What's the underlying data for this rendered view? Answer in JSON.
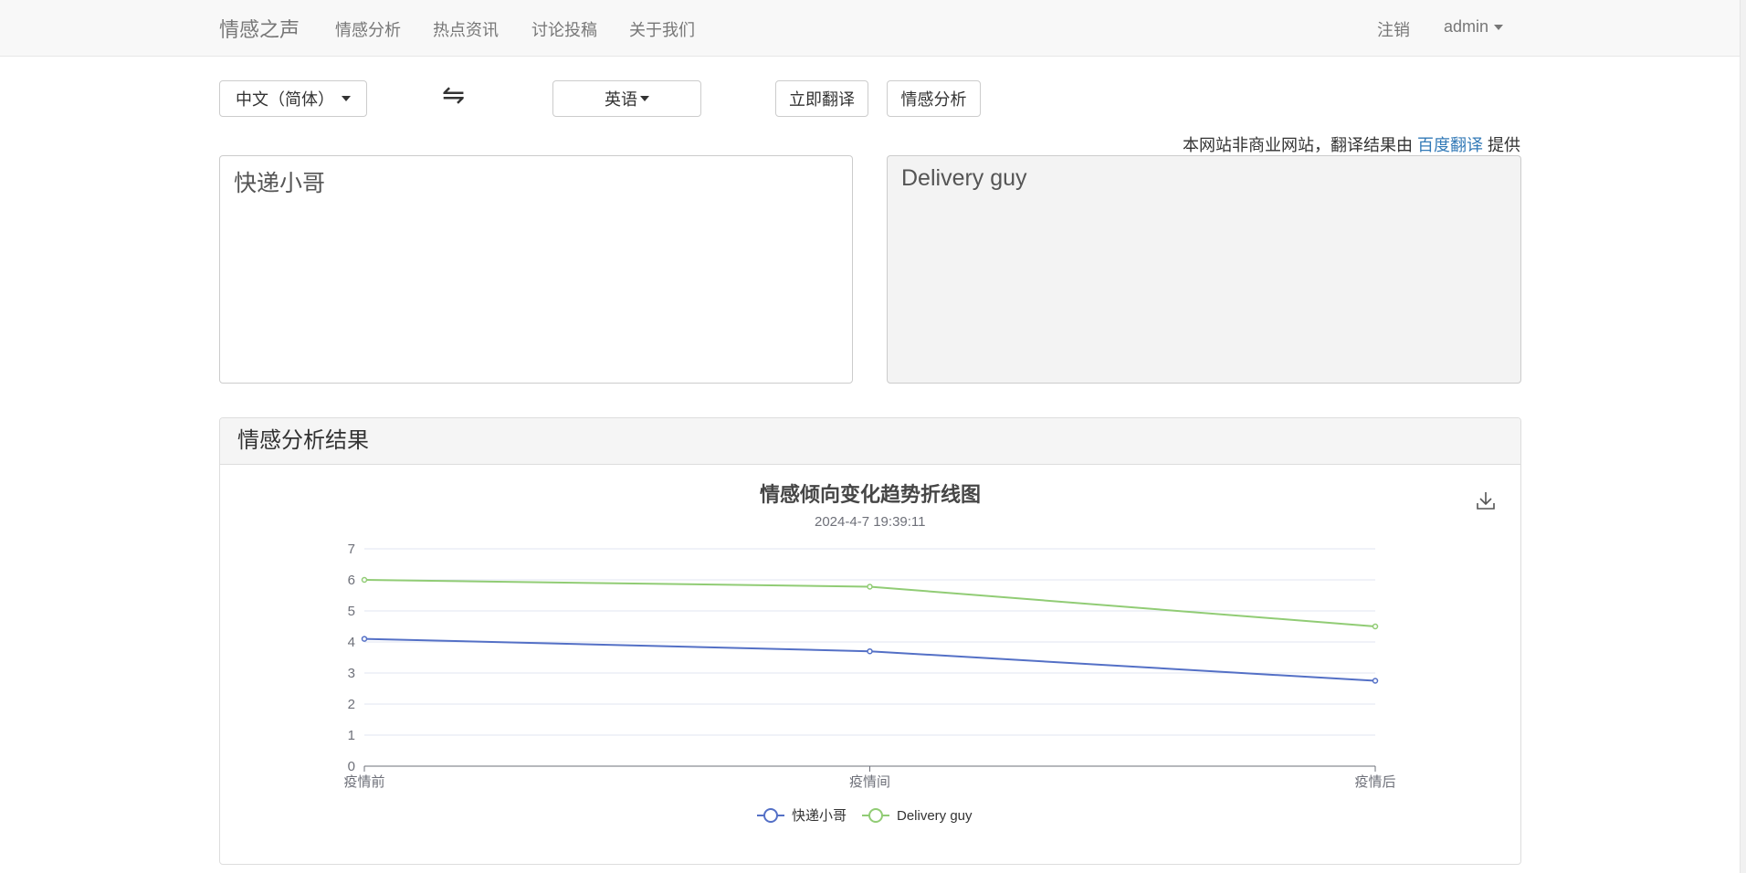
{
  "nav": {
    "brand": "情感之声",
    "links": [
      "情感分析",
      "热点资讯",
      "讨论投稿",
      "关于我们"
    ],
    "logout": "注销",
    "user": "admin"
  },
  "toolbar": {
    "source_lang": "中文（简体）",
    "swap_icon": "⇋",
    "target_lang": "英语",
    "translate_button": "立即翻译",
    "analyze_button": "情感分析"
  },
  "notice": {
    "prefix": "本网站非商业网站，翻译结果由",
    "link": "百度翻译",
    "suffix": "提供"
  },
  "source_text": "快递小哥",
  "target_text": "Delivery guy",
  "panel": {
    "title": "情感分析结果",
    "download_icon": "download-icon"
  },
  "chart_data": {
    "type": "line",
    "title": "情感倾向变化趋势折线图",
    "subtitle": "2024-4-7 19:39:11",
    "categories": [
      "疫情前",
      "疫情间",
      "疫情后"
    ],
    "ylim": [
      0,
      7
    ],
    "yticks": [
      0,
      1,
      2,
      3,
      4,
      5,
      6,
      7
    ],
    "grid": true,
    "legend_position": "bottom",
    "series": [
      {
        "name": "快递小哥",
        "values": [
          4.1,
          3.7,
          2.75
        ],
        "color": "#5470c6"
      },
      {
        "name": "Delivery guy",
        "values": [
          6.0,
          5.78,
          4.5
        ],
        "color": "#91cc75"
      }
    ]
  }
}
